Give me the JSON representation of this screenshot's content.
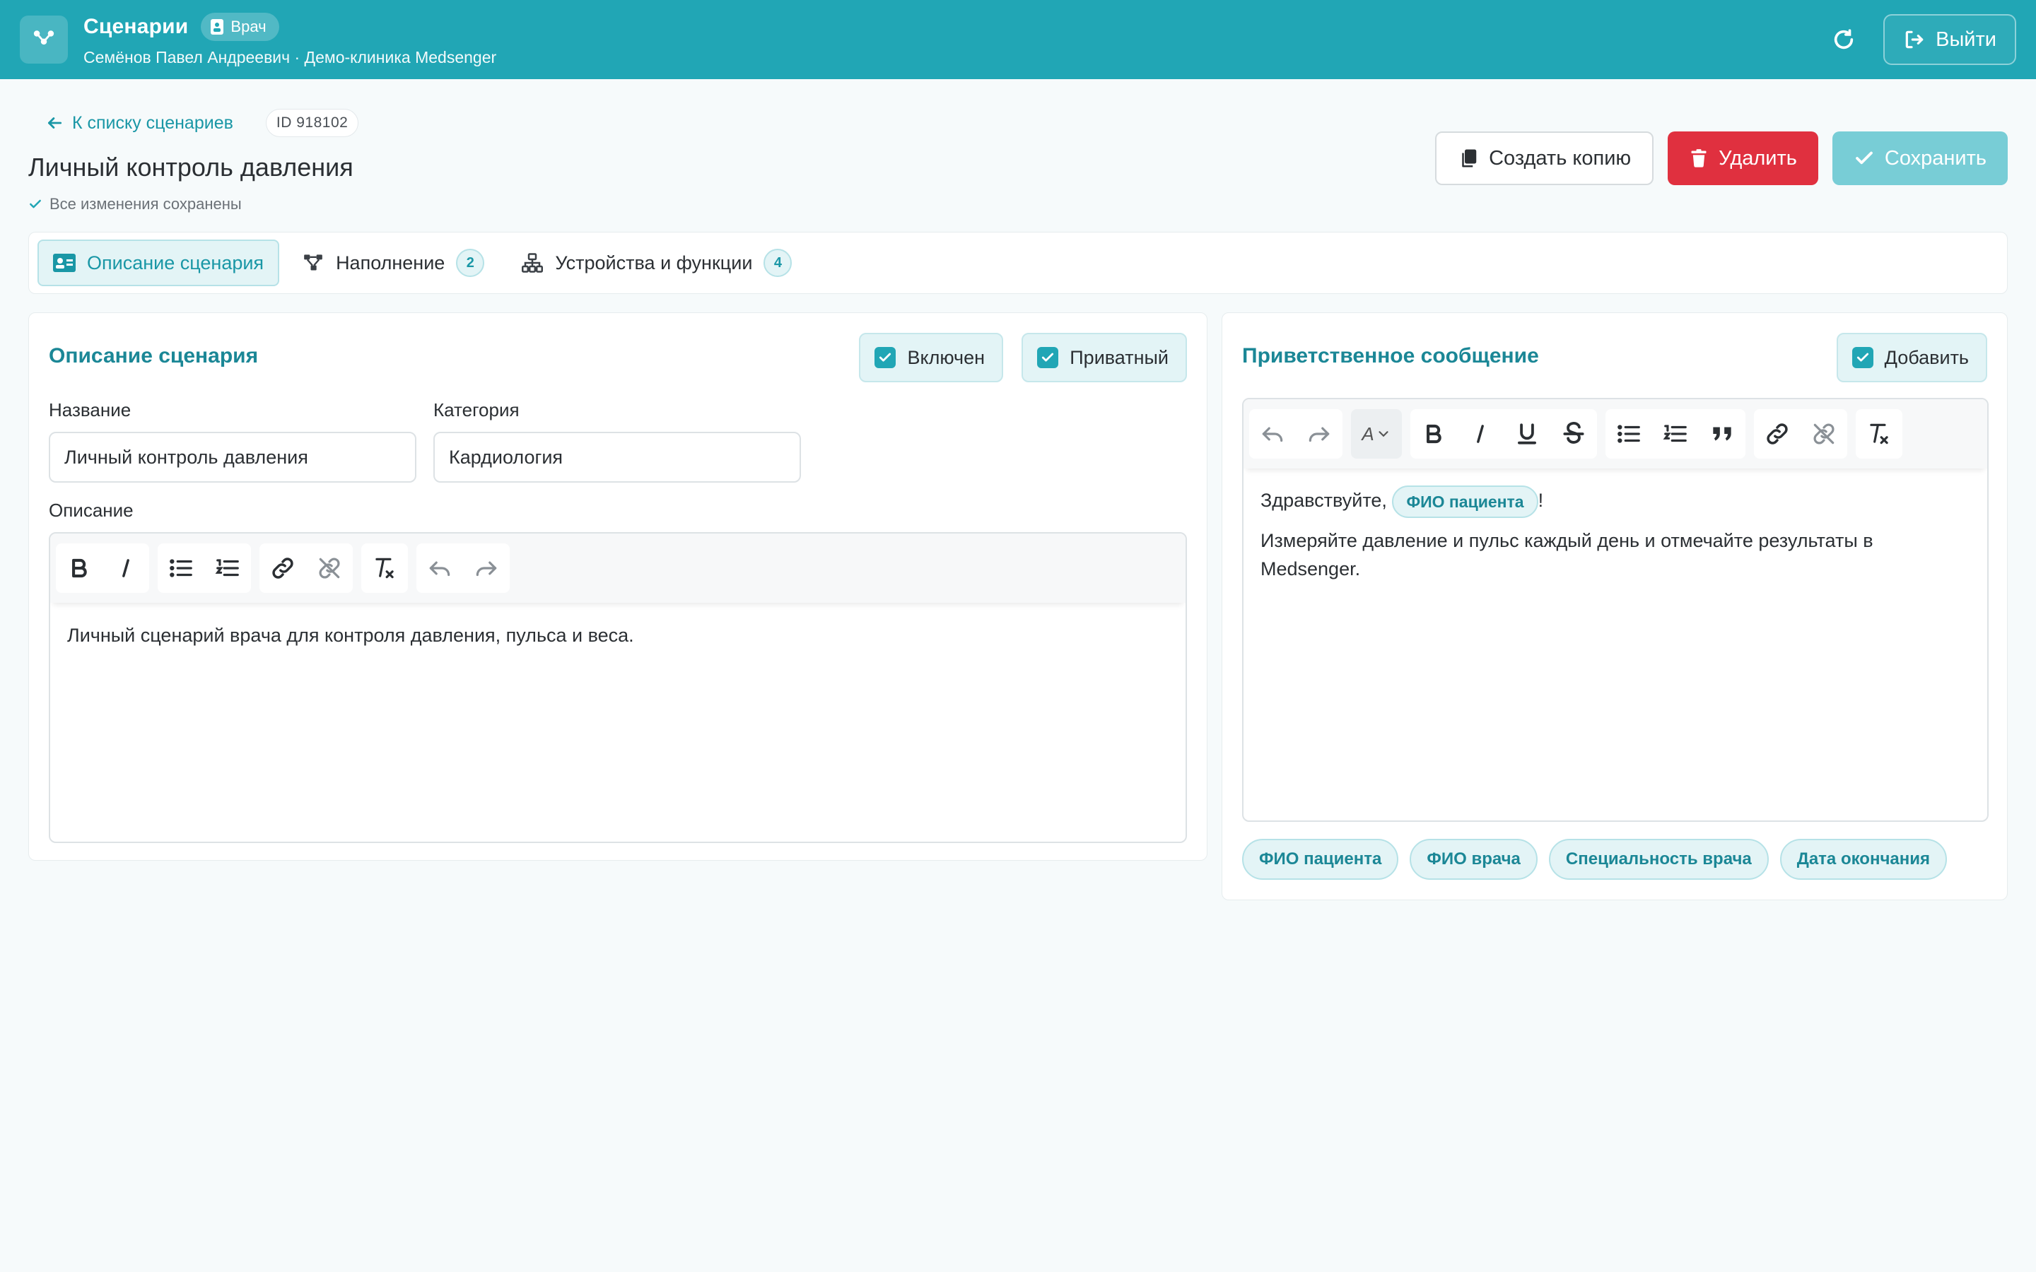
{
  "header": {
    "title": "Сценарии",
    "role_badge": "Врач",
    "subtitle": "Семёнов Павел Андреевич · Демо-клиника Medsenger",
    "logout_label": "Выйти"
  },
  "page": {
    "back_label": "К списку сценариев",
    "id_label": "ID 918102",
    "title": "Личный контроль давления",
    "save_status": "Все изменения сохранены"
  },
  "actions": {
    "copy_label": "Создать копию",
    "delete_label": "Удалить",
    "save_label": "Сохранить"
  },
  "tabs": [
    {
      "label": "Описание сценария",
      "active": true
    },
    {
      "label": "Наполнение",
      "count": "2"
    },
    {
      "label": "Устройства и функции",
      "count": "4"
    }
  ],
  "description_card": {
    "title": "Описание сценария",
    "enabled_label": "Включен",
    "private_label": "Приватный",
    "name_label": "Название",
    "name_value": "Личный контроль давления",
    "category_label": "Категория",
    "category_value": "Кардиология",
    "description_label": "Описание",
    "description_text": "Личный сценарий врача для контроля давления, пульса и веса."
  },
  "welcome_card": {
    "title": "Приветственное сообщение",
    "add_label": "Добавить",
    "font_select_value": "A",
    "greeting": "Здравствуйте,",
    "greeting_chip": "ФИО пациента",
    "greeting_end": "!",
    "body_text": "Измеряйте давление и пульс каждый день и отмечайте результаты в Medsenger.",
    "variables": [
      "ФИО пациента",
      "ФИО врача",
      "Специальность врача",
      "Дата окончания"
    ]
  },
  "colors": {
    "accent": "#21a6b5",
    "accent_dark": "#1b8796",
    "danger": "#e0303f",
    "save_disabled": "#78cdd6"
  }
}
